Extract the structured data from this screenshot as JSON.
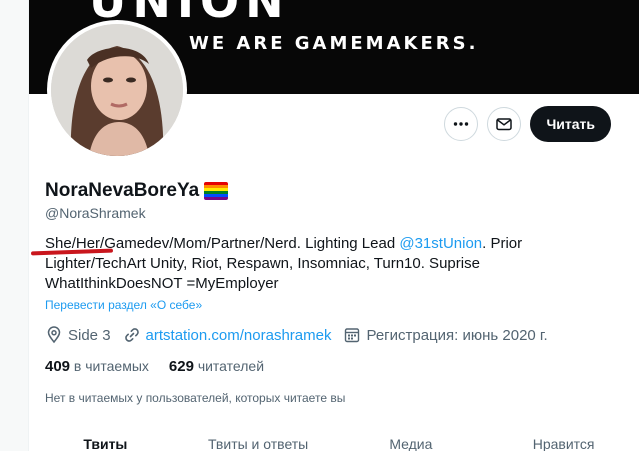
{
  "banner": {
    "logo_text": "UNION",
    "tagline": "WE ARE GAMEMAKERS."
  },
  "profile": {
    "display_name": "NoraNevaBoreYa",
    "flag_icon": "rainbow-flag-icon",
    "handle": "@NoraShramek",
    "bio_part1": "She/Her/Gamedev/Mom/Partner/Nerd. Lighting Lead ",
    "bio_mention": "@31stUnion",
    "bio_part2": ". Prior Lighter/TechArt Unity, Riot, Respawn, Insomniac, Turn10. Suprise WhatIthinkDoesNOT =MyEmployer",
    "translate_label": "Перевести раздел «О себе»",
    "location": "Side 3",
    "website": "artstation.com/norashramek",
    "joined": "Регистрация: июнь 2020 г.",
    "following_count": "409",
    "following_label": "в читаемых",
    "followers_count": "629",
    "followers_label": "читателей",
    "mutuals_note": "Нет в читаемых у пользователей, которых читаете вы"
  },
  "actions": {
    "more_icon": "more-icon",
    "message_icon": "mail-icon",
    "follow_label": "Читать"
  },
  "tabs": [
    {
      "label": "Твиты"
    },
    {
      "label": "Твиты и ответы"
    },
    {
      "label": "Медиа"
    },
    {
      "label": "Нравится"
    }
  ],
  "colors": {
    "accent": "#1d9bf0",
    "annotation": "#c9161d",
    "text_primary": "#0f1419",
    "text_secondary": "#536471"
  }
}
